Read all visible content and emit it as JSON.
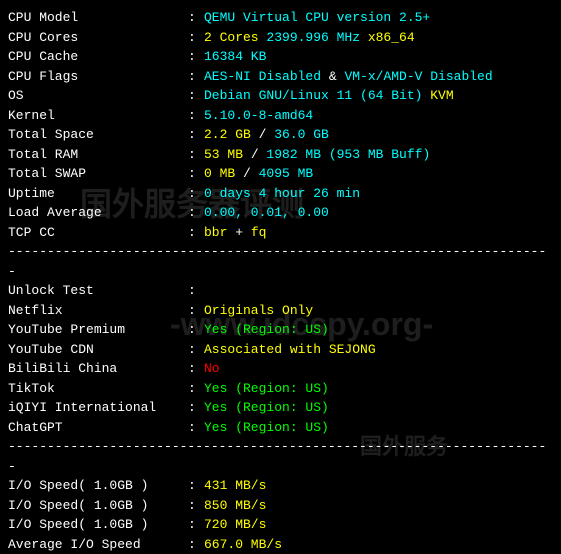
{
  "sysinfo": {
    "cpu_model": {
      "label": "CPU Model",
      "value": "QEMU Virtual CPU version 2.5+",
      "color": "cyan"
    },
    "cpu_cores": {
      "label": "CPU Cores",
      "value1": "2 Cores",
      "value2": " 2399.996 MHz ",
      "value3": "x86_64"
    },
    "cpu_cache": {
      "label": "CPU Cache",
      "value": "16384 KB",
      "color": "cyan"
    },
    "cpu_flags": {
      "label": "CPU Flags",
      "v1": "AES-NI Disabled",
      "amp": " & ",
      "v2": "VM-x/AMD-V Disabled"
    },
    "os": {
      "label": "OS",
      "v1": "Debian GNU/Linux 11 (64 Bit)",
      "v2": " KVM"
    },
    "kernel": {
      "label": "Kernel",
      "value": "5.10.0-8-amd64",
      "color": "cyan"
    },
    "total_space": {
      "label": "Total Space",
      "v1": "2.2 GB",
      "sep": " / ",
      "v2": "36.0 GB"
    },
    "total_ram": {
      "label": "Total RAM",
      "v1": "53 MB",
      "sep": " / ",
      "v2": "1982 MB",
      "v3": " (953 MB Buff)"
    },
    "total_swap": {
      "label": "Total SWAP",
      "v1": "0 MB",
      "sep": " / ",
      "v2": "4095 MB"
    },
    "uptime": {
      "label": "Uptime",
      "value": "0 days 4 hour 26 min",
      "color": "cyan"
    },
    "load_avg": {
      "label": "Load Average",
      "value": "0.00, 0.01, 0.00",
      "color": "cyan"
    },
    "tcp_cc": {
      "label": "TCP CC",
      "v1": "bbr",
      "plus": " + ",
      "v2": "fq"
    }
  },
  "unlock": {
    "header": {
      "label": "Unlock Test",
      "value": ""
    },
    "netflix": {
      "label": "Netflix",
      "value": "Originals Only",
      "color": "yellow"
    },
    "yt_premium": {
      "label": "YouTube Premium",
      "value": "Yes (Region: US)",
      "color": "green"
    },
    "yt_cdn": {
      "label": "YouTube CDN",
      "value": "Associated with SEJONG",
      "color": "yellow"
    },
    "bilibili": {
      "label": "BiliBili China",
      "value": "No",
      "color": "red"
    },
    "tiktok": {
      "label": "TikTok",
      "value": "Yes (Region: US)",
      "color": "green"
    },
    "iqiyi": {
      "label": "iQIYI International",
      "value": "Yes (Region: US)",
      "color": "green"
    },
    "chatgpt": {
      "label": "ChatGPT",
      "value": "Yes (Region: US)",
      "color": "green"
    }
  },
  "io": {
    "io1": {
      "label": "I/O Speed( 1.0GB )",
      "value": "431 MB/s",
      "color": "yellow"
    },
    "io2": {
      "label": "I/O Speed( 1.0GB )",
      "value": "850 MB/s",
      "color": "yellow"
    },
    "io3": {
      "label": "I/O Speed( 1.0GB )",
      "value": "720 MB/s",
      "color": "yellow"
    },
    "io_avg": {
      "label": "Average I/O Speed",
      "value": "667.0 MB/s",
      "color": "yellow"
    }
  },
  "chart_data": {
    "type": "table",
    "title": "System Benchmark Output",
    "system": {
      "cpu_model": "QEMU Virtual CPU version 2.5+",
      "cpu_cores": 2,
      "cpu_mhz": 2399.996,
      "arch": "x86_64",
      "cpu_cache_kb": 16384,
      "aes_ni": false,
      "vmx_amd_v": false,
      "os": "Debian GNU/Linux 11 (64 Bit)",
      "virt": "KVM",
      "kernel": "5.10.0-8-amd64",
      "disk_used_gb": 2.2,
      "disk_total_gb": 36.0,
      "ram_used_mb": 53,
      "ram_total_mb": 1982,
      "ram_buff_mb": 953,
      "swap_used_mb": 0,
      "swap_total_mb": 4095,
      "uptime": "0 days 4 hour 26 min",
      "load_average": [
        0.0,
        0.01,
        0.0
      ],
      "tcp_cc": "bbr + fq"
    },
    "unlock": {
      "Netflix": "Originals Only",
      "YouTube Premium": "Yes (Region: US)",
      "YouTube CDN": "Associated with SEJONG",
      "BiliBili China": "No",
      "TikTok": "Yes (Region: US)",
      "iQIYI International": "Yes (Region: US)",
      "ChatGPT": "Yes (Region: US)"
    },
    "io_speed_mb_s": [
      431,
      850,
      720
    ],
    "io_speed_avg_mb_s": 667.0
  },
  "divider": "----------------------------------------------------------------------"
}
